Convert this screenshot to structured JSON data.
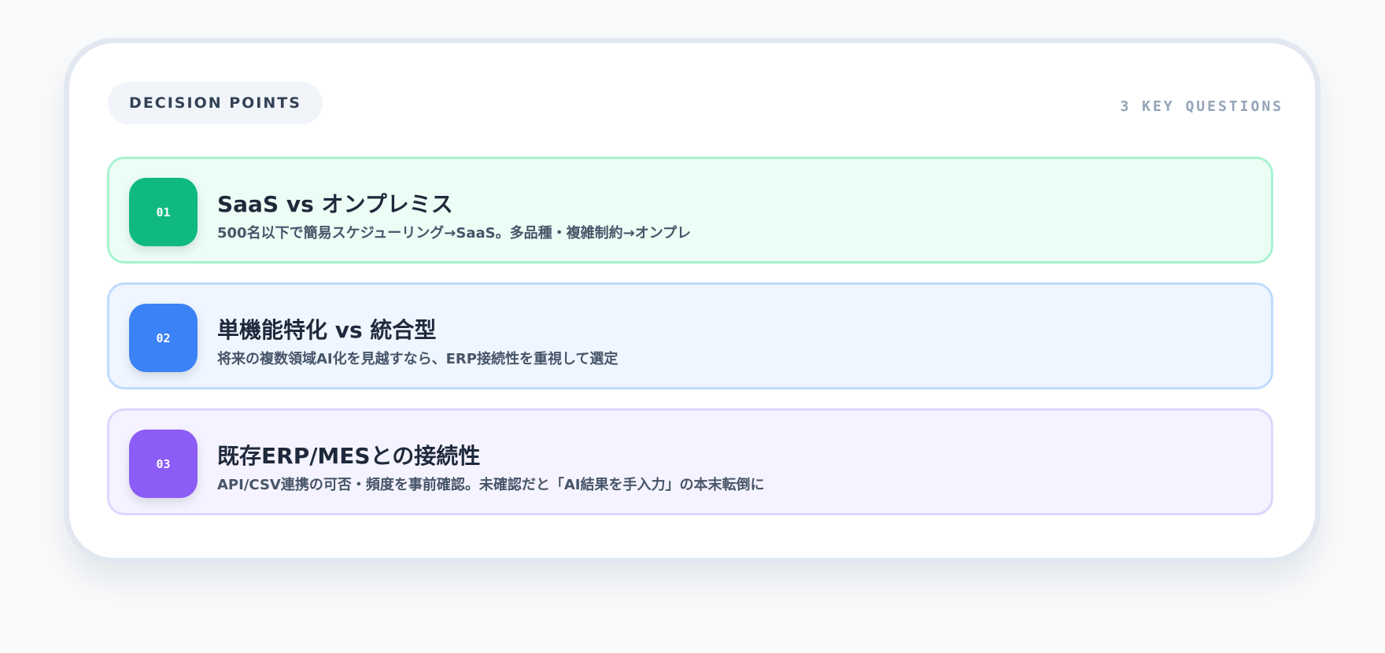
{
  "header": {
    "label": "DECISION POINTS",
    "count": "3 KEY QUESTIONS"
  },
  "items": [
    {
      "num": "01",
      "title": "SaaS vs オンプレミス",
      "desc": "500名以下で簡易スケジューリング→SaaS。多品種・複雑制約→オンプレ",
      "accent": "#10b981",
      "bg": "#ecfdf5",
      "border": "#a7f3d0"
    },
    {
      "num": "02",
      "title": "単機能特化 vs 統合型",
      "desc": "将来の複数領域AI化を見越すなら、ERP接続性を重視して選定",
      "accent": "#3b82f6",
      "bg": "#eff6ff",
      "border": "#bfdbfe"
    },
    {
      "num": "03",
      "title": "既存ERP/MESとの接続性",
      "desc": "API/CSV連携の可否・頻度を事前確認。未確認だと「AI結果を手入力」の本末転倒に",
      "accent": "#8b5cf6",
      "bg": "#f5f3ff",
      "border": "#ddd6fe"
    }
  ]
}
